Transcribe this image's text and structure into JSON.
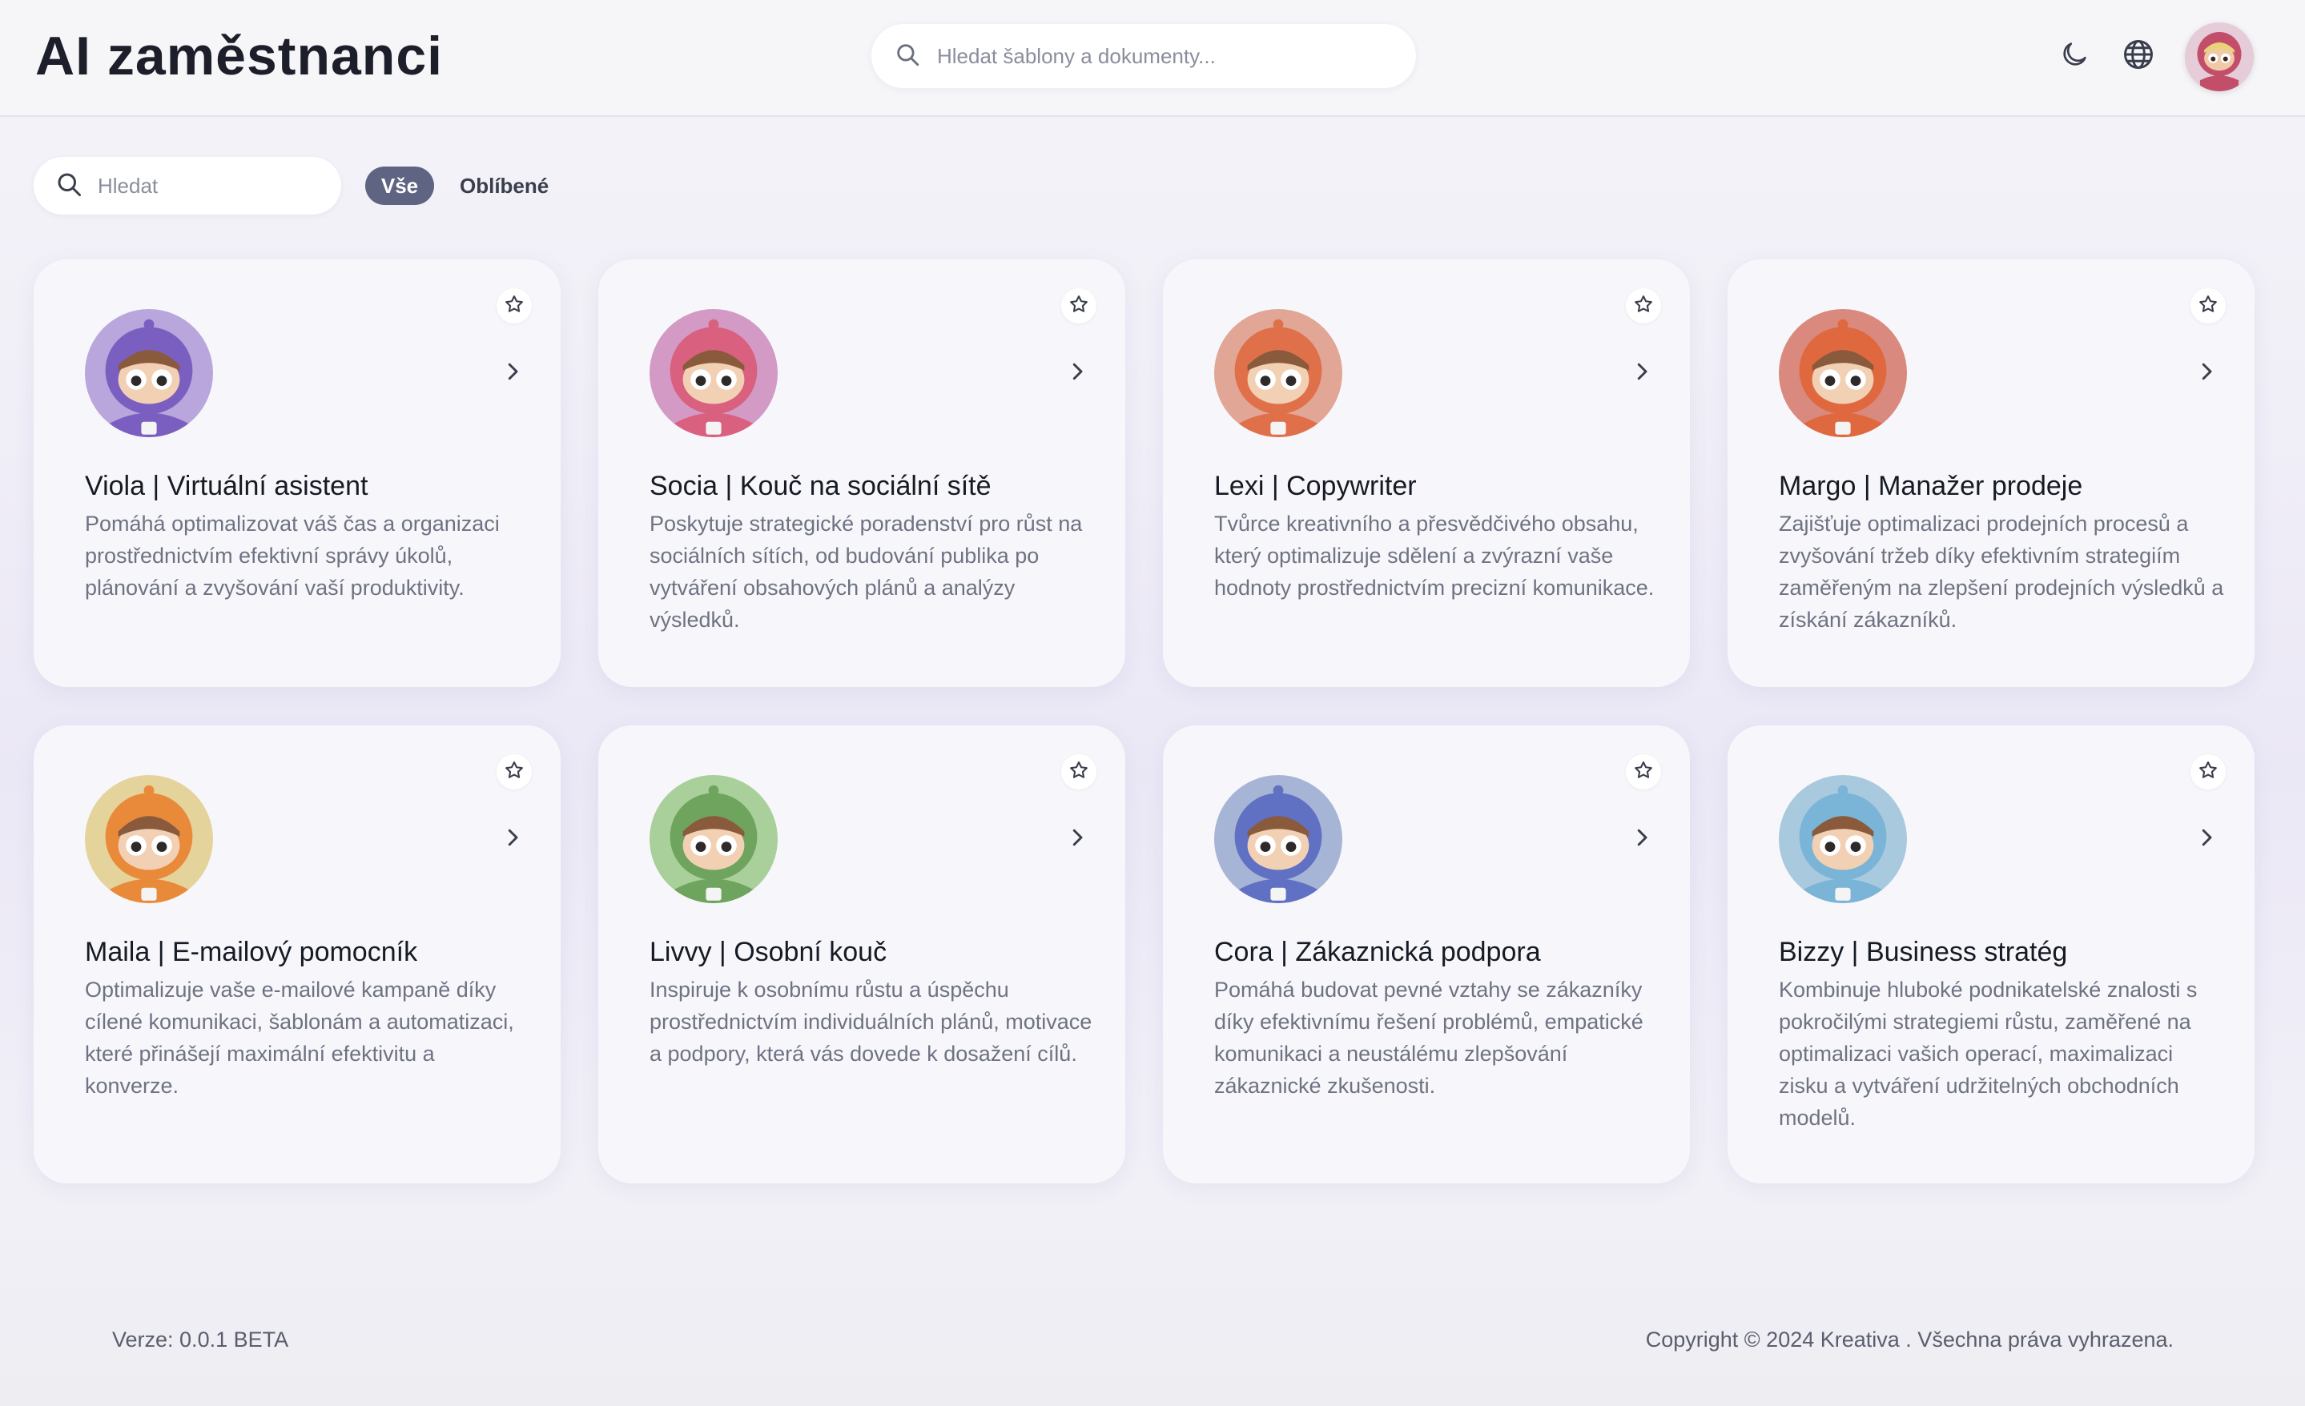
{
  "header": {
    "title": "AI zaměstnanci",
    "search_placeholder": "Hledat šablony a dokumenty...",
    "icons": [
      "moon-icon",
      "globe-icon"
    ]
  },
  "filters": {
    "search_placeholder": "Hledat",
    "all_label": "Vše",
    "favorites_label": "Oblíbené"
  },
  "cards": [
    {
      "name": "Viola | Virtuální asistent",
      "description": "Pomáhá optimalizovat váš čas a organizaci prostřednictvím efektivní správy úkolů, plánování a zvyšování vaší produktivity.",
      "bg": "#b9a6dc",
      "suit": "#7a5fc0"
    },
    {
      "name": "Socia | Kouč na sociální sítě",
      "description": "Poskytuje strategické poradenství pro růst na sociálních sítích, od budování publika po vytváření obsahových plánů a analýzy výsledků.",
      "bg": "#d29ac4",
      "suit": "#d9607e"
    },
    {
      "name": "Lexi | Copywriter",
      "description": "Tvůrce kreativního a přesvědčivého obsahu, který optimalizuje sdělení a zvýrazní vaše hodnoty prostřednictvím precizní komunikace.",
      "bg": "#e1a696",
      "suit": "#e0704a"
    },
    {
      "name": "Margo | Manažer prodeje",
      "description": "Zajišťuje optimalizaci prodejních procesů a zvyšování tržeb díky efektivním strategiím zaměřeným na zlepšení prodejních výsledků a získání zákazníků.",
      "bg": "#d9897d",
      "suit": "#e0683e"
    },
    {
      "name": "Maila | E-mailový pomocník",
      "description": "Optimalizuje vaše e-mailové kampaně díky cílené komunikaci, šablonám a automatizaci, které přinášejí maximální efektivitu a konverze.",
      "bg": "#e5d39c",
      "suit": "#e98a3a"
    },
    {
      "name": "Livvy | Osobní kouč",
      "description": "Inspiruje k osobnímu růstu a úspěchu prostřednictvím individuálních plánů, motivace a podpory, která vás dovede k dosažení cílů.",
      "bg": "#a9cf9a",
      "suit": "#6fa45e"
    },
    {
      "name": "Cora | Zákaznická podpora",
      "description": "Pomáhá budovat pevné vztahy se zákazníky díky efektivnímu řešení problémů, empatické komunikaci a neustálému zlepšování zákaznické zkušenosti.",
      "bg": "#a6b4d6",
      "suit": "#6070c2"
    },
    {
      "name": "Bizzy | Business stratég",
      "description": "Kombinuje hluboké podnikatelské znalosti s pokročilými strategiemi růstu, zaměřené na optimalizaci vašich operací, maximalizaci zisku a vytváření udržitelných obchodních modelů.",
      "bg": "#a9c9de",
      "suit": "#7ab4d6"
    }
  ],
  "footer": {
    "version": "Verze: 0.0.1 BETA",
    "copyright": "Copyright © 2024 Kreativa . Všechna práva vyhrazena."
  }
}
